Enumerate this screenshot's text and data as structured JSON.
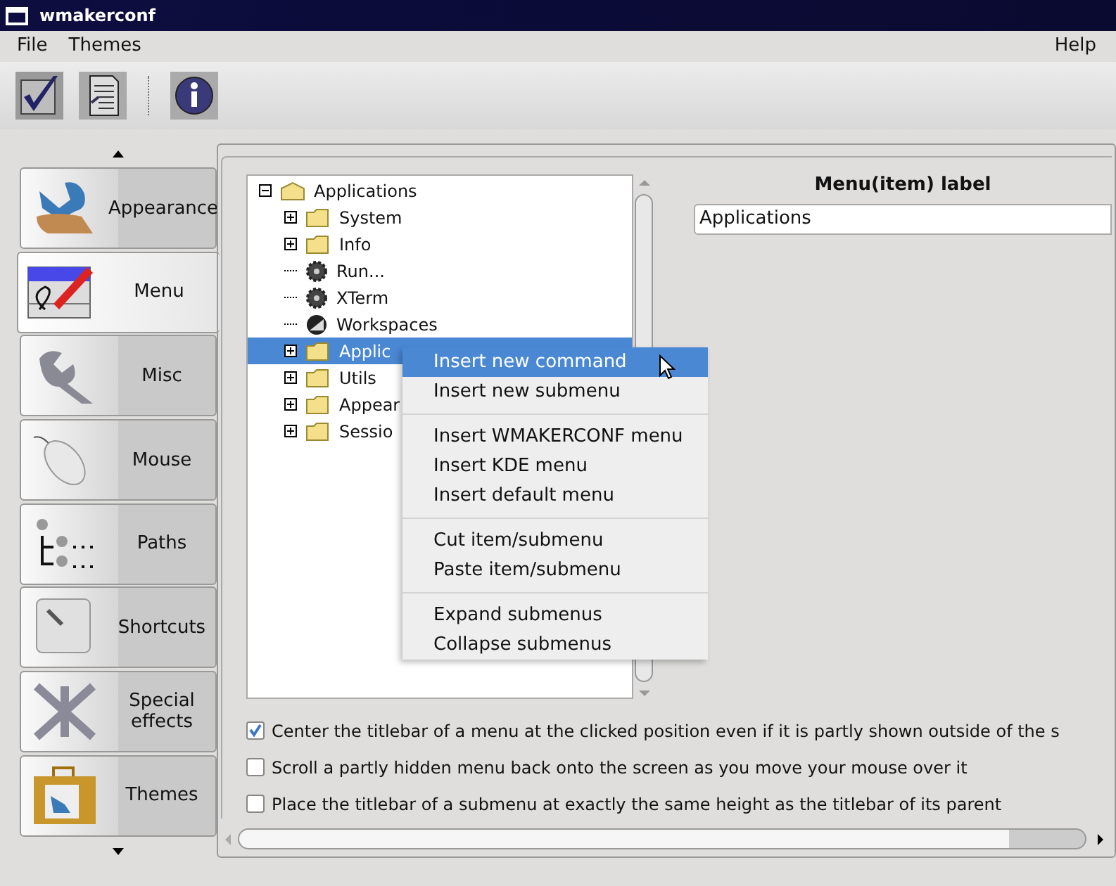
{
  "window": {
    "title": "wmakerconf"
  },
  "menubar": {
    "items": [
      "File",
      "Themes"
    ],
    "help": "Help"
  },
  "toolbar": [
    {
      "kind": "apply"
    },
    {
      "kind": "save"
    },
    {
      "kind": "separator"
    },
    {
      "kind": "info"
    }
  ],
  "sidebar": {
    "items": [
      {
        "label": "Appearance",
        "kind": "appearance",
        "selected": false
      },
      {
        "label": "Menu",
        "kind": "menu",
        "selected": true
      },
      {
        "label": "Misc",
        "kind": "misc",
        "selected": false
      },
      {
        "label": "Mouse",
        "kind": "mouse",
        "selected": false
      },
      {
        "label": "Paths",
        "kind": "paths",
        "selected": false
      },
      {
        "label": "Shortcuts",
        "kind": "shortcuts",
        "selected": false
      },
      {
        "label": "Special effects",
        "kind": "effects",
        "selected": false
      },
      {
        "label": "Themes",
        "kind": "themes",
        "selected": false
      }
    ]
  },
  "tree": {
    "label": "Applications",
    "kind": "root",
    "expanded": true,
    "selected": false,
    "children": [
      {
        "label": "System",
        "kind": "folder",
        "expanded": false,
        "selected": false
      },
      {
        "label": "Info",
        "kind": "folder",
        "expanded": false,
        "selected": false
      },
      {
        "label": "Run...",
        "kind": "command",
        "selected": false
      },
      {
        "label": "XTerm",
        "kind": "command",
        "selected": false
      },
      {
        "label": "Workspaces",
        "kind": "workspaces",
        "selected": false
      },
      {
        "label": "Applic",
        "kind": "folder",
        "expanded": false,
        "selected": true
      },
      {
        "label": "Utils",
        "kind": "folder",
        "expanded": false,
        "selected": false
      },
      {
        "label": "Appear",
        "kind": "folder",
        "expanded": false,
        "selected": false
      },
      {
        "label": "Sessio",
        "kind": "folder",
        "expanded": false,
        "selected": false
      }
    ]
  },
  "context_menu": [
    [
      {
        "label": "Insert new command",
        "selected": true
      },
      {
        "label": "Insert new submenu",
        "selected": false
      }
    ],
    [
      {
        "label": "Insert WMAKERCONF menu",
        "selected": false
      },
      {
        "label": "Insert KDE menu",
        "selected": false
      },
      {
        "label": "Insert default menu",
        "selected": false
      }
    ],
    [
      {
        "label": "Cut item/submenu",
        "selected": false
      },
      {
        "label": "Paste item/submenu",
        "selected": false
      }
    ],
    [
      {
        "label": "Expand submenus",
        "selected": false
      },
      {
        "label": "Collapse submenus",
        "selected": false
      }
    ]
  ],
  "label_field": {
    "label": "Menu(item) label",
    "value": "Applications"
  },
  "options": [
    {
      "label": "Center the titlebar of a menu at the clicked position even if it is partly shown outside of the s",
      "checked": true
    },
    {
      "label": "Scroll a partly hidden menu back onto the screen as you move your mouse over it",
      "checked": false
    },
    {
      "label": "Place the titlebar of a submenu at exactly the same height as the titlebar of its parent",
      "checked": false
    }
  ]
}
